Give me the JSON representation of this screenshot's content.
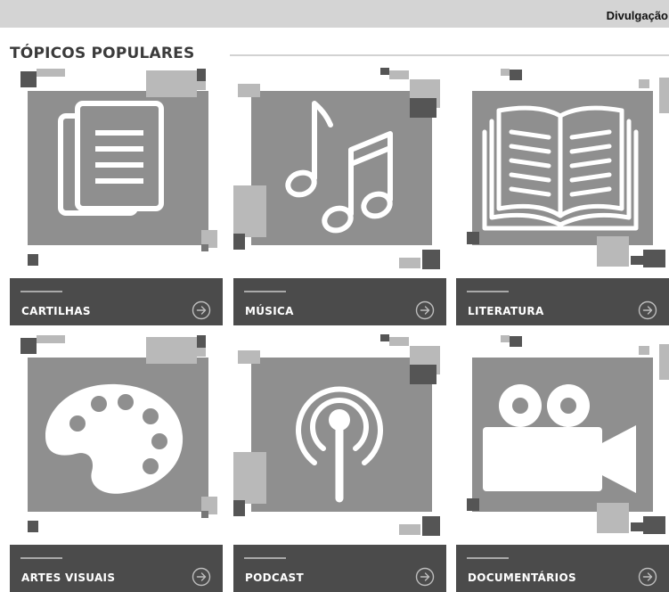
{
  "credit": "Divulgação",
  "section": {
    "title": "TÓPICOS POPULARES"
  },
  "cards": [
    {
      "label": "CARTILHAS",
      "icon": "documents-icon"
    },
    {
      "label": "MÚSICA",
      "icon": "music-notes-icon"
    },
    {
      "label": "LITERATURA",
      "icon": "open-book-icon"
    },
    {
      "label": "ARTES VISUAIS",
      "icon": "palette-icon"
    },
    {
      "label": "PODCAST",
      "icon": "podcast-icon"
    },
    {
      "label": "DOCUMENTÁRIOS",
      "icon": "video-camera-icon"
    }
  ],
  "colors": {
    "panel": "#8f8f8f",
    "footer": "#4b4b4b",
    "icon": "#ffffff",
    "light_square": "#b9b9b9",
    "dark_square": "#555555"
  }
}
